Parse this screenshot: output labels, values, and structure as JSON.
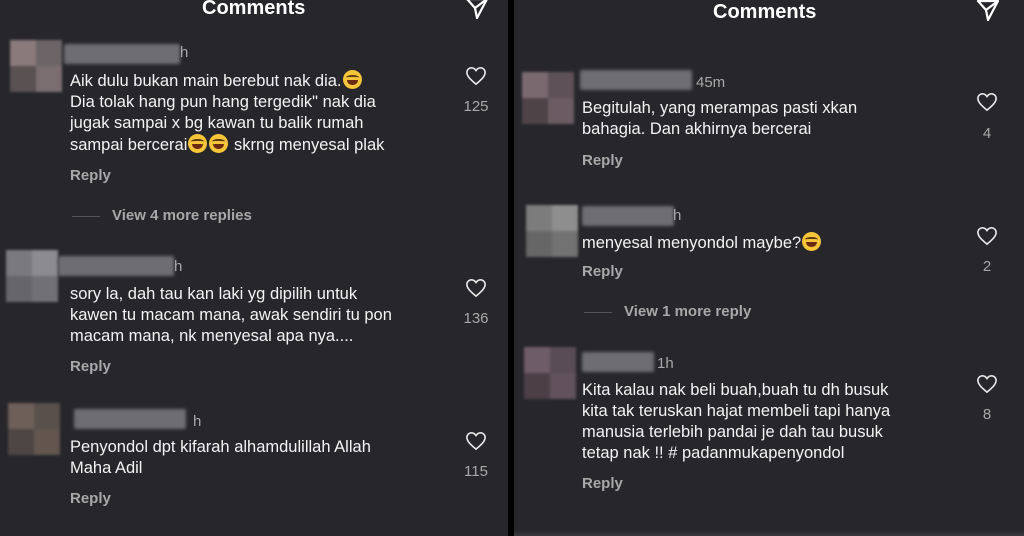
{
  "left": {
    "header_title": "Comments",
    "comments": [
      {
        "time": "h",
        "text": "Aik dulu bukan main berebut nak dia.{e}\nDia tolak hang pun hang tergedik\" nak dia\njugak sampai x bg kawan tu balik rumah\nsampai bercerai{e}{e} skrng menyesal plak",
        "likes": "125",
        "reply_label": "Reply",
        "view_more": "View 4 more replies"
      },
      {
        "time": "h",
        "text": "sory la, dah tau kan laki yg dipilih untuk\nkawen tu macam mana, awak sendiri tu pon\nmacam mana, nk menyesal apa nya....",
        "likes": "136",
        "reply_label": "Reply"
      },
      {
        "time": "h",
        "text": "Penyondol dpt kifarah alhamdulillah Allah\nMaha Adil",
        "likes": "115",
        "reply_label": "Reply"
      }
    ]
  },
  "right": {
    "header_title": "Comments",
    "comments": [
      {
        "time": "45m",
        "text": "Begitulah, yang merampas pasti xkan\nbahagia. Dan akhirnya bercerai",
        "likes": "4",
        "reply_label": "Reply"
      },
      {
        "time": "h",
        "text": "menyesal menyondol maybe?{e}",
        "likes": "2",
        "reply_label": "Reply",
        "view_more": "View 1 more reply"
      },
      {
        "time": "1h",
        "text": "Kita kalau nak beli buah,buah tu dh busuk\nkita tak teruskan hajat membeli tapi hanya\nmanusia terlebih pandai je dah tau busuk\ntetap nak !! # padanmukapenyondol",
        "likes": "8",
        "reply_label": "Reply"
      }
    ]
  },
  "icons": {
    "share": "send-icon",
    "like": "heart-outline-icon",
    "emoji": "face-with-tears-of-joy-icon"
  },
  "colors": {
    "background": "#27272b",
    "text": "#f3f3f3",
    "muted": "#a8a8a8"
  }
}
